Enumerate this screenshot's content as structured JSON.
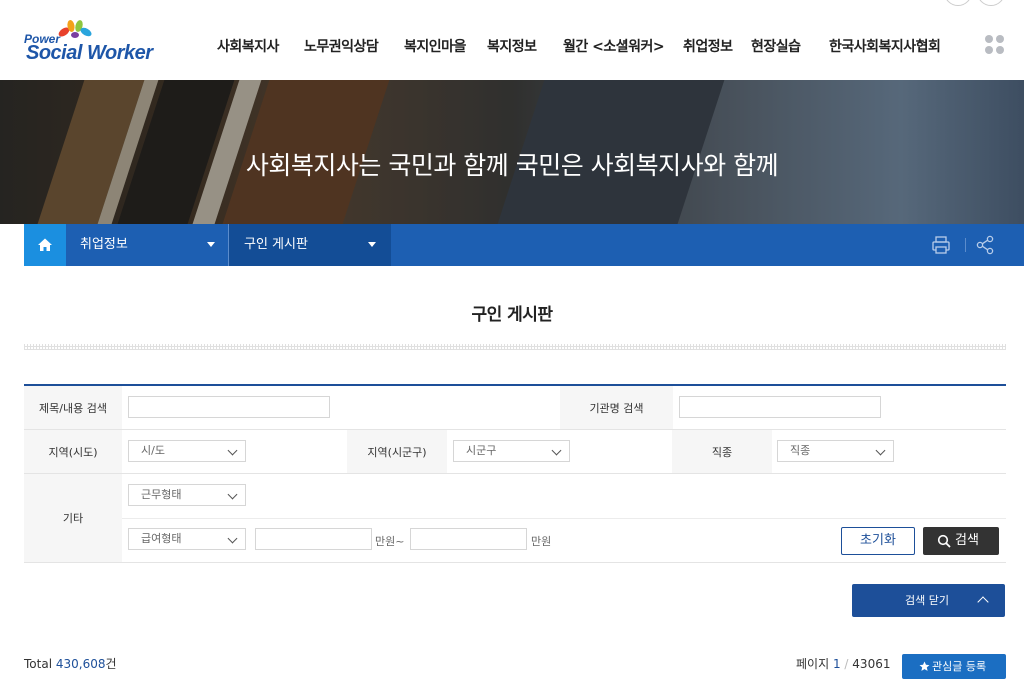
{
  "logo": {
    "power": "Power",
    "name": "Social Worker"
  },
  "gnb": [
    "사회복지사",
    "노무권익상담",
    "복지인마을",
    "복지정보",
    "월간 <소셜워커>",
    "취업정보",
    "현장실습",
    "한국사회복지사협회"
  ],
  "banner": {
    "slogan": "사회복지사는 국민과 함께 국민은 사회복지사와 함께"
  },
  "location": {
    "depth1": "취업정보",
    "depth2": "구인 게시판"
  },
  "page": {
    "title": "구인 게시판"
  },
  "search": {
    "title_label": "제목/내용 검색",
    "title_value": "",
    "org_label": "기관명 검색",
    "org_value": "",
    "region_label": "지역(시도)",
    "region_value": "시/도",
    "district_label": "지역(시군구)",
    "district_value": "시군구",
    "job_label": "직종",
    "job_value": "직종",
    "etc_label": "기타",
    "worktype_value": "근무형태",
    "paytype_value": "급여형태",
    "pay_min": "",
    "pay_max": "",
    "unit_from": "만원~",
    "unit_to": "만원",
    "reset_label": "초기화",
    "search_label": "검색",
    "close_label": "검색 닫기"
  },
  "list": {
    "total_prefix": "Total",
    "total_count": "430,608",
    "total_suffix": "건",
    "page_prefix": "페이지",
    "page_current": "1",
    "page_sep": "/",
    "page_total": "43061",
    "fav_label": "관심글 등록"
  },
  "colors": {
    "primary": "#1d4f99",
    "locbar": "#1d5fb2",
    "home": "#1b8fe0",
    "fav": "#1b6ec2"
  }
}
